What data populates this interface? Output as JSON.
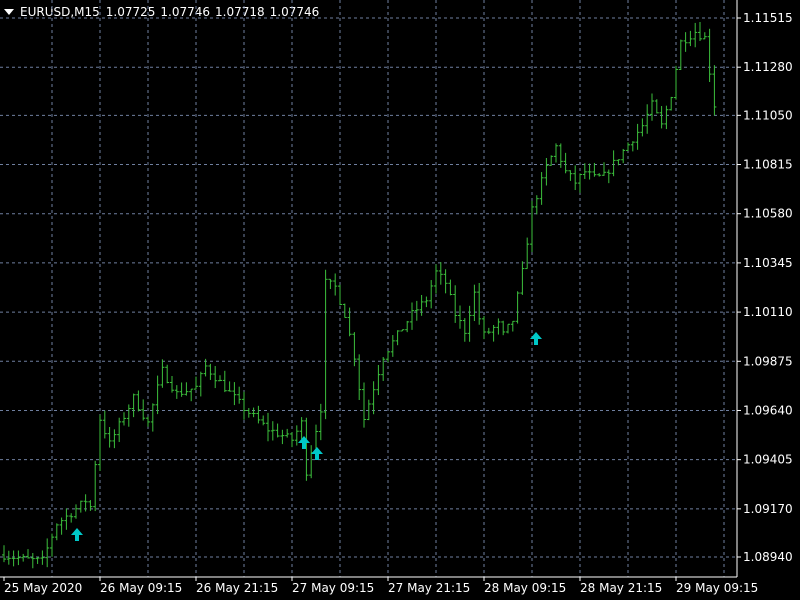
{
  "header": {
    "symbol_timeframe": "EURUSD,M15",
    "open": "1.07725",
    "high": "1.07746",
    "low": "1.07718",
    "close": "1.07746"
  },
  "colors": {
    "background": "#000000",
    "grid": "#6f7f9f",
    "bars": "#3cbf3c",
    "signal": "#00c8c8",
    "text": "#ffffff"
  },
  "chart_data": {
    "type": "ohlc",
    "symbol": "EURUSD",
    "timeframe": "M15",
    "grid": true,
    "y_ticks": [
      "1.11515",
      "1.11280",
      "1.11050",
      "1.10815",
      "1.10580",
      "1.10345",
      "1.10110",
      "1.09875",
      "1.09640",
      "1.09405",
      "1.09170",
      "1.08940"
    ],
    "x_ticks": [
      "25 May 2020",
      "26 May 09:15",
      "26 May 21:15",
      "27 May 09:15",
      "27 May 21:15",
      "28 May 09:15",
      "28 May 21:15",
      "29 May 09:15"
    ],
    "ylim": [
      1.08835,
      1.1159
    ],
    "price_path": [
      [
        0,
        1.0895
      ],
      [
        4,
        1.0893
      ],
      [
        8,
        1.0892
      ],
      [
        11,
        1.091
      ],
      [
        14,
        1.0915
      ],
      [
        17,
        1.0921
      ],
      [
        18,
        1.0918
      ],
      [
        20,
        1.096
      ],
      [
        22,
        1.0948
      ],
      [
        27,
        1.097
      ],
      [
        30,
        1.0958
      ],
      [
        33,
        1.0983
      ],
      [
        36,
        1.0972
      ],
      [
        40,
        1.0975
      ],
      [
        42,
        1.0985
      ],
      [
        46,
        1.0975
      ],
      [
        50,
        1.0965
      ],
      [
        55,
        1.0955
      ],
      [
        60,
        1.095
      ],
      [
        62,
        1.0958
      ],
      [
        63,
        1.0935
      ],
      [
        64,
        1.0945
      ],
      [
        66,
        1.0965
      ],
      [
        67,
        1.1025
      ],
      [
        69,
        1.1023
      ],
      [
        71,
        1.101
      ],
      [
        73,
        1.099
      ],
      [
        75,
        1.096
      ],
      [
        77,
        1.0975
      ],
      [
        79,
        1.099
      ],
      [
        82,
        1.1
      ],
      [
        85,
        1.101
      ],
      [
        88,
        1.1017
      ],
      [
        90,
        1.103
      ],
      [
        92,
        1.1025
      ],
      [
        94,
        1.101
      ],
      [
        96,
        1.1002
      ],
      [
        98,
        1.102
      ],
      [
        99,
        1.1008
      ],
      [
        100,
        1.1
      ],
      [
        103,
        1.1005
      ],
      [
        104,
        1.1
      ],
      [
        106,
        1.1007
      ],
      [
        108,
        1.103
      ],
      [
        110,
        1.106
      ],
      [
        113,
        1.108
      ],
      [
        115,
        1.109
      ],
      [
        117,
        1.1078
      ],
      [
        119,
        1.1073
      ],
      [
        121,
        1.1078
      ],
      [
        123,
        1.1075
      ],
      [
        125,
        1.1076
      ],
      [
        128,
        1.1085
      ],
      [
        131,
        1.1094
      ],
      [
        133,
        1.11
      ],
      [
        135,
        1.111
      ],
      [
        137,
        1.11
      ],
      [
        139,
        1.1115
      ],
      [
        141,
        1.114
      ],
      [
        144,
        1.1145
      ],
      [
        146,
        1.1142
      ],
      [
        148,
        1.111
      ]
    ],
    "bar_count": 149,
    "signals": [
      {
        "type": "buy-arrow",
        "time": "25 May 2020 ~21:15",
        "price": 1.09
      },
      {
        "type": "buy-arrow",
        "time": "27 May ~06:00",
        "price": 1.0942
      },
      {
        "type": "buy-arrow",
        "time": "27 May ~07:00",
        "price": 1.0936
      },
      {
        "type": "buy-arrow",
        "time": "28 May ~08:30",
        "price": 1.0993
      }
    ]
  }
}
